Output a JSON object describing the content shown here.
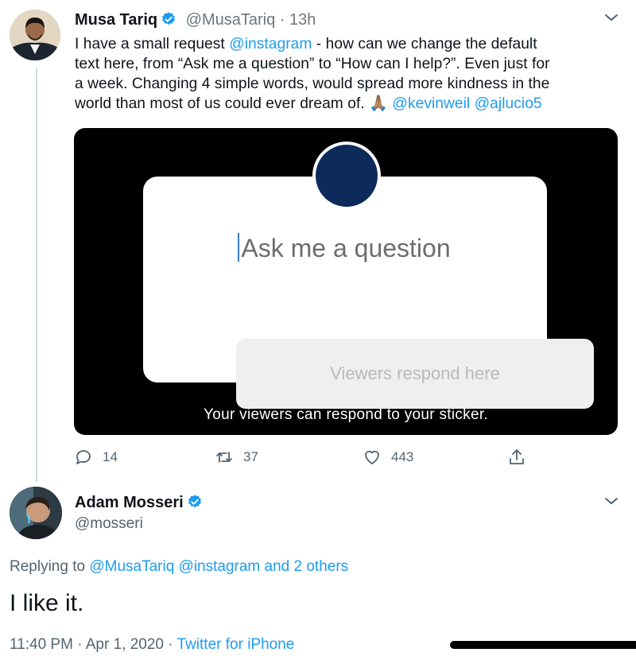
{
  "tweet1": {
    "author_name": "Musa Tariq",
    "handle": "@MusaTariq",
    "time": "13h",
    "lines": [
      {
        "pre": "I have a small request ",
        "link": "@instagram",
        "post": " - how can we change the default"
      },
      {
        "pre": "text here, from “Ask me a question” to “How can I help?”. Even just for"
      },
      {
        "pre": "a week. Changing 4 simple words, would spread more kindness in the"
      },
      {
        "pre": "world than most of us could ever dream of. 🙏🏽 ",
        "link": "@kevinweil",
        "post": " ",
        "link2": "@ajlucio5"
      }
    ],
    "media": {
      "prompt": "Ask me a question",
      "response_placeholder": "Viewers respond here",
      "caption": "Your viewers can respond to your sticker."
    },
    "actions": {
      "replies": "14",
      "retweets": "37",
      "likes": "443"
    }
  },
  "tweet2": {
    "author_name": "Adam Mosseri",
    "handle": "@mosseri",
    "replying_prefix": "Replying to ",
    "replying_links": "@MusaTariq @instagram and 2 others",
    "text": "I like it.",
    "timestamp": "11:40 PM · Apr 1, 2020 · ",
    "source": "Twitter for iPhone"
  },
  "colors": {
    "link": "#1d9bf0",
    "verified": "#1d9bf0",
    "sticker_avatar": "#0d2b5a"
  }
}
